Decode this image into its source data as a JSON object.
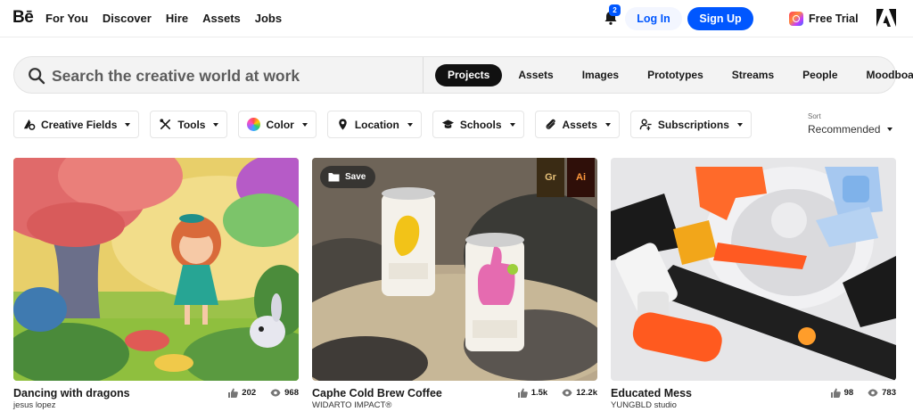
{
  "app": {
    "logo": "Bē",
    "nav": [
      "For You",
      "Discover",
      "Hire",
      "Assets",
      "Jobs"
    ],
    "notifications_count": "2",
    "login_label": "Log In",
    "signup_label": "Sign Up",
    "trial_label": "Free Trial",
    "accent_color": "#0057ff"
  },
  "search": {
    "placeholder": "Search the creative world at work",
    "tabs": [
      "Projects",
      "Assets",
      "Images",
      "Prototypes",
      "Streams",
      "People",
      "Moodboards"
    ],
    "active_tab": "Projects"
  },
  "filters": [
    {
      "label": "Creative Fields",
      "icon": "creative-fields-icon"
    },
    {
      "label": "Tools",
      "icon": "tools-icon"
    },
    {
      "label": "Color",
      "icon": "color-wheel-icon"
    },
    {
      "label": "Location",
      "icon": "location-pin-icon"
    },
    {
      "label": "Schools",
      "icon": "graduation-cap-icon"
    },
    {
      "label": "Assets",
      "icon": "paperclip-icon"
    },
    {
      "label": "Subscriptions",
      "icon": "subscriptions-icon"
    }
  ],
  "sort": {
    "label": "Sort",
    "value": "Recommended"
  },
  "projects": [
    {
      "title": "Dancing with dragons",
      "owner": "jesus lopez",
      "appreciations": "202",
      "views": "968"
    },
    {
      "title": "Caphe Cold Brew Coffee",
      "owner": "WIDARTO IMPACT®",
      "appreciations": "1.5k",
      "views": "12.2k",
      "save_label": "Save",
      "tool_badges": [
        "Gr",
        "Ai"
      ]
    },
    {
      "title": "Educated Mess",
      "owner": "YUNGBLD studio",
      "appreciations": "98",
      "views": "783"
    }
  ]
}
